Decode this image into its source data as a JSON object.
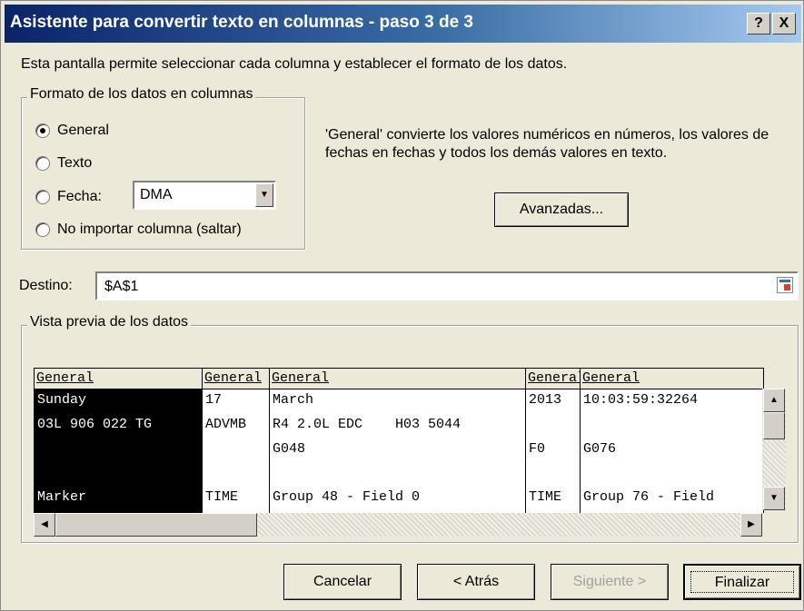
{
  "window": {
    "title": "Asistente para convertir texto en columnas - paso 3 de 3",
    "help_label": "?",
    "close_label": "X"
  },
  "intro_text": "Esta pantalla permite seleccionar cada columna y establecer el formato de los datos.",
  "format_group": {
    "legend": "Formato de los datos en columnas",
    "options": [
      {
        "label": "General",
        "checked": true
      },
      {
        "label": "Texto",
        "checked": false
      },
      {
        "label": "Fecha:",
        "checked": false
      },
      {
        "label": "No importar columna (saltar)",
        "checked": false
      }
    ],
    "date_format_value": "DMA"
  },
  "description": "'General' convierte los valores numéricos en números, los valores de fechas en fechas y todos los demás valores en texto.",
  "advanced_button": "Avanzadas...",
  "destination": {
    "label": "Destino:",
    "value": "$A$1"
  },
  "preview": {
    "legend": "Vista previa de los datos",
    "columns": [
      {
        "header": "General",
        "cells": [
          "Sunday",
          "03L 906 022 TG",
          "",
          "",
          "Marker"
        ],
        "selected": true
      },
      {
        "header": "General",
        "cells": [
          "17",
          "ADVMB",
          "",
          "",
          "TIME"
        ],
        "selected": false
      },
      {
        "header": "General",
        "cells": [
          "March",
          "R4 2.0L EDC    H03 5044",
          "G048",
          "",
          "Group 48 - Field 0"
        ],
        "selected": false
      },
      {
        "header": "General",
        "cells": [
          "2013",
          "",
          "F0",
          "",
          "TIME"
        ],
        "selected": false
      },
      {
        "header": "General",
        "cells": [
          "10:03:59:32264",
          "",
          "G076",
          "",
          "Group 76 - Field"
        ],
        "selected": false
      }
    ]
  },
  "buttons": {
    "cancel": "Cancelar",
    "back": "< Atrás",
    "next": "Siguiente >",
    "finish": "Finalizar"
  },
  "colors": {
    "dialog_bg": "#ece9d8",
    "title_gradient_start": "#0a246a",
    "title_gradient_end": "#a6caf0",
    "selected_column_bg": "#000000"
  }
}
